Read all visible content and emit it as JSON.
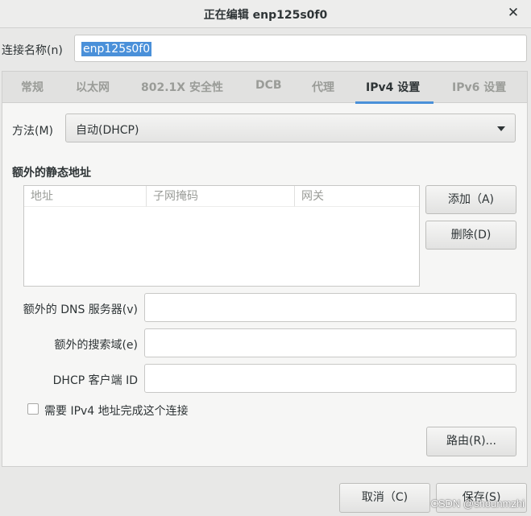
{
  "window": {
    "title": "正在编辑 enp125s0f0",
    "close_glyph": "✕"
  },
  "connection": {
    "label": "连接名称(n)",
    "value": "enp125s0f0"
  },
  "tabs": [
    {
      "label": "常规"
    },
    {
      "label": "以太网"
    },
    {
      "label": "802.1X 安全性"
    },
    {
      "label": "DCB"
    },
    {
      "label": "代理"
    },
    {
      "label": "IPv4 设置"
    },
    {
      "label": "IPv6 设置"
    }
  ],
  "active_tab": "IPv4 设置",
  "ipv4": {
    "method_label": "方法(M)",
    "method_value": "自动(DHCP)",
    "static_title": "额外的静态地址",
    "columns": [
      "地址",
      "子网掩码",
      "网关"
    ],
    "add_button": "添加（A)",
    "delete_button": "删除(D)",
    "dns_label": "额外的 DNS 服务器(v)",
    "dns_value": "",
    "search_label": "额外的搜索域(e)",
    "search_value": "",
    "dhcp_label": "DHCP 客户端 ID",
    "dhcp_value": "",
    "require_label": "需要 IPv4 地址完成这个连接",
    "require_checked": false,
    "routes_button": "路由(R)..."
  },
  "footer": {
    "cancel_button": "取消（C)",
    "save_button": "保存(S)"
  },
  "watermark": "CSDN @shounmzhi",
  "colors": {
    "accent": "#4a90d9",
    "background": "#e8e8e7",
    "panel": "#f6f6f5"
  }
}
